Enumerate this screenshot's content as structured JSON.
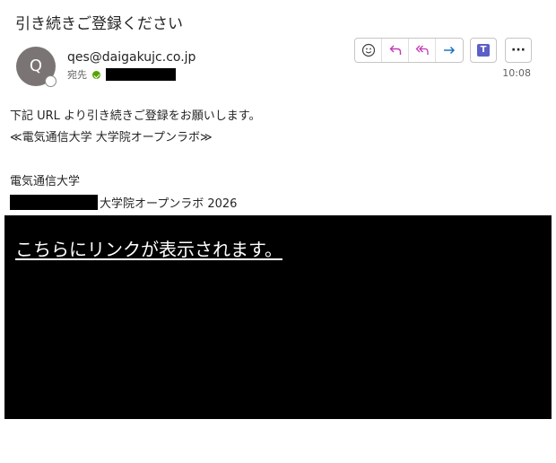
{
  "email": {
    "subject": "引き続きご登録ください",
    "avatar_initial": "Q",
    "sender": "qes@daigakujc.co.jp",
    "to_label": "宛先",
    "time": "10:08"
  },
  "toolbar": {
    "icons": [
      "emoji-icon",
      "reply-icon",
      "reply-all-icon",
      "forward-icon",
      "teams-icon",
      "more-icon"
    ],
    "teams_glyph": "T",
    "more_label": "···"
  },
  "body": {
    "line1": "下記 URL より引き続きご登録をお願いします。",
    "line2": "≪電気通信大学 大学院オープンラボ≫",
    "line3": "電気通信大学",
    "line4_suffix": "大学院オープンラボ 2026",
    "link_text": "こちらにリンクが表示されます。"
  },
  "colors": {
    "accent": "#c239b3",
    "forward": "#0f6cbd",
    "teams": "#5b5fc7",
    "verified": "#57a300"
  }
}
